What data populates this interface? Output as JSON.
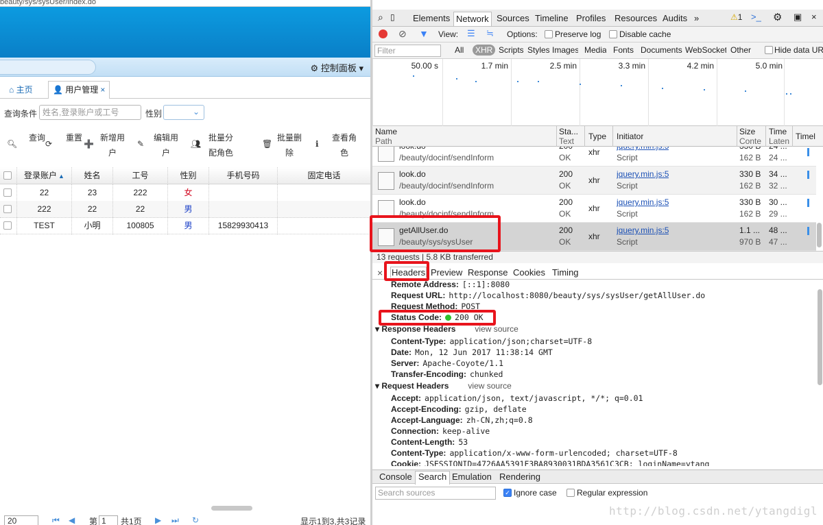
{
  "app": {
    "url_fragment": "beauty/sys/sysUser/index.do",
    "control_panel": "控制面板",
    "tabs": [
      {
        "label": "主页"
      },
      {
        "label": "用户管理",
        "close": "×"
      }
    ],
    "search": {
      "label": "查询条件",
      "placeholder": "姓名,登录账户或工号",
      "gender_label": "性别"
    },
    "toolbar": [
      {
        "icon": "search-icon",
        "label": "查询"
      },
      {
        "icon": "refresh-icon",
        "label": "重置"
      },
      {
        "icon": "add-user-icon",
        "label": "新增用户"
      },
      {
        "icon": "edit-icon",
        "label": "编辑用户"
      },
      {
        "icon": "users-icon",
        "label": "批量分配角色"
      },
      {
        "icon": "trash-icon",
        "label": "批量删除"
      },
      {
        "icon": "info-icon",
        "label": "查看角色"
      }
    ],
    "grid": {
      "headers": [
        "登录账户",
        "姓名",
        "工号",
        "性别",
        "手机号码",
        "固定电话"
      ],
      "sort_indicator": "▲",
      "rows": [
        {
          "account": "22",
          "name": "23",
          "no": "222",
          "gender": "女",
          "phone": "",
          "tel": ""
        },
        {
          "account": "222",
          "name": "22",
          "no": "22",
          "gender": "男",
          "phone": "",
          "tel": ""
        },
        {
          "account": "TEST",
          "name": "小明",
          "no": "100805",
          "gender": "男",
          "phone": "15829930413",
          "tel": ""
        }
      ]
    },
    "pager": {
      "page_size": "20",
      "page_prefix": "第",
      "page": "1",
      "page_suffix": "共1页",
      "summary": "显示1到3,共3记录"
    }
  },
  "devtools": {
    "tabs": [
      "Elements",
      "Network",
      "Sources",
      "Timeline",
      "Profiles",
      "Resources",
      "Audits",
      "»"
    ],
    "active_tab": "Network",
    "warning_count": "1",
    "view_label": "View:",
    "options_label": "Options:",
    "preserve_log": "Preserve log",
    "disable_cache": "Disable cache",
    "filter_placeholder": "Filter",
    "types": [
      "All",
      "XHR",
      "Scripts",
      "Styles",
      "Images",
      "Media",
      "Fonts",
      "Documents",
      "WebSockets",
      "Other"
    ],
    "hide_data_urls": "Hide data URLs",
    "timeline_labels": [
      "50.00 s",
      "1.7 min",
      "2.5 min",
      "3.3 min",
      "4.2 min",
      "5.0 min",
      "5"
    ],
    "columns": {
      "name": "Name",
      "path": "Path",
      "status": "Sta...",
      "status2": "Text",
      "type": "Type",
      "initiator": "Initiator",
      "size": "Size",
      "size2": "Conte",
      "time": "Time",
      "time2": "Laten",
      "timeline": "Timel"
    },
    "requests": [
      {
        "name": "look.do",
        "path": "/beauty/docinf/sendInform",
        "status": "200",
        "text": "OK",
        "type": "xhr",
        "initiator": "jquery.min.js:5",
        "initiator_type": "Script",
        "size": "330 B",
        "content": "162 B",
        "time": "24 ...",
        "latency": "24 ..."
      },
      {
        "name": "look.do",
        "path": "/beauty/docinf/sendInform",
        "status": "200",
        "text": "OK",
        "type": "xhr",
        "initiator": "jquery.min.js:5",
        "initiator_type": "Script",
        "size": "330 B",
        "content": "162 B",
        "time": "34 ...",
        "latency": "32 ..."
      },
      {
        "name": "look.do",
        "path": "/beauty/docinf/sendInform",
        "status": "200",
        "text": "OK",
        "type": "xhr",
        "initiator": "jquery.min.js:5",
        "initiator_type": "Script",
        "size": "330 B",
        "content": "162 B",
        "time": "30 ...",
        "latency": "29 ..."
      },
      {
        "name": "getAllUser.do",
        "path": "/beauty/sys/sysUser",
        "status": "200",
        "text": "OK",
        "type": "xhr",
        "initiator": "jquery.min.js:5",
        "initiator_type": "Script",
        "size": "1.1 ...",
        "content": "970 B",
        "time": "48 ...",
        "latency": "47 ..."
      }
    ],
    "summary": "13 requests | 5.8 KB transferred",
    "detail_tabs": [
      "Headers",
      "Preview",
      "Response",
      "Cookies",
      "Timing"
    ],
    "general": [
      {
        "k": "Remote Address:",
        "v": "[::1]:8080"
      },
      {
        "k": "Request URL:",
        "v": "http://localhost:8080/beauty/sys/sysUser/getAllUser.do"
      },
      {
        "k": "Request Method:",
        "v": "POST"
      },
      {
        "k": "Status Code:",
        "v": "200 OK"
      }
    ],
    "response_headers_title": "Response Headers",
    "request_headers_title": "Request Headers",
    "view_source": "view source",
    "response_headers": [
      {
        "k": "Content-Type:",
        "v": "application/json;charset=UTF-8"
      },
      {
        "k": "Date:",
        "v": "Mon, 12 Jun 2017 11:38:14 GMT"
      },
      {
        "k": "Server:",
        "v": "Apache-Coyote/1.1"
      },
      {
        "k": "Transfer-Encoding:",
        "v": "chunked"
      }
    ],
    "request_headers": [
      {
        "k": "Accept:",
        "v": "application/json, text/javascript, */*; q=0.01"
      },
      {
        "k": "Accept-Encoding:",
        "v": "gzip, deflate"
      },
      {
        "k": "Accept-Language:",
        "v": "zh-CN,zh;q=0.8"
      },
      {
        "k": "Connection:",
        "v": "keep-alive"
      },
      {
        "k": "Content-Length:",
        "v": "53"
      },
      {
        "k": "Content-Type:",
        "v": "application/x-www-form-urlencoded; charset=UTF-8"
      },
      {
        "k": "Cookie:",
        "v": "JSESSIONID=4726AA5391F3BA8930031BDA3561C3CB; loginName=ytang"
      }
    ],
    "drawer_tabs": [
      "Console",
      "Search",
      "Emulation",
      "Rendering"
    ],
    "search_placeholder": "Search sources",
    "ignore_case": "Ignore case",
    "regex": "Regular expression"
  },
  "watermark": "http://blog.csdn.net/ytangdigl",
  "colors": {
    "header_blue": "#0a8fd6",
    "highlight_red": "#e8141c",
    "link": "#1b50b5",
    "status_green": "#2ec02e"
  }
}
